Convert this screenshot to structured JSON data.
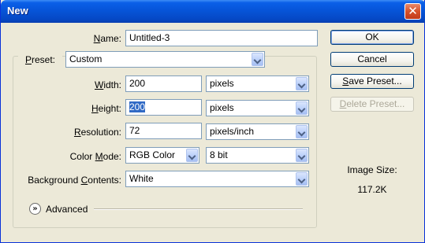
{
  "window": {
    "title": "New",
    "close_glyph": "✕"
  },
  "name": {
    "label_mnemonic": "N",
    "label_rest": "ame:",
    "value": "Untitled-3"
  },
  "preset": {
    "label_mnemonic": "P",
    "label_rest": "reset:",
    "value": "Custom"
  },
  "width": {
    "label_mnemonic": "W",
    "label_rest": "idth:",
    "value": "200",
    "unit": "pixels"
  },
  "height": {
    "label_mnemonic": "H",
    "label_rest": "eight:",
    "value": "200",
    "unit": "pixels"
  },
  "resolution": {
    "label_mnemonic": "R",
    "label_rest": "esolution:",
    "value": "72",
    "unit": "pixels/inch"
  },
  "color_mode": {
    "label_pre": "Color ",
    "label_mnemonic": "M",
    "label_rest": "ode:",
    "value": "RGB Color",
    "depth": "8 bit"
  },
  "background": {
    "label_pre": "Background ",
    "label_mnemonic": "C",
    "label_rest": "ontents:",
    "value": "White"
  },
  "advanced": {
    "label": "Advanced",
    "icon": "expand-chevron-icon",
    "glyph": "»"
  },
  "buttons": {
    "ok": "OK",
    "cancel": "Cancel",
    "save_mnemonic": "S",
    "save_rest": "ave Preset...",
    "delete_mnemonic": "D",
    "delete_rest": "elete Preset..."
  },
  "image_size": {
    "label": "Image Size:",
    "value": "117.2K"
  },
  "colors": {
    "titlebar": "#0653d6",
    "dialog_bg": "#ece9d8",
    "selection": "#316ac5"
  }
}
